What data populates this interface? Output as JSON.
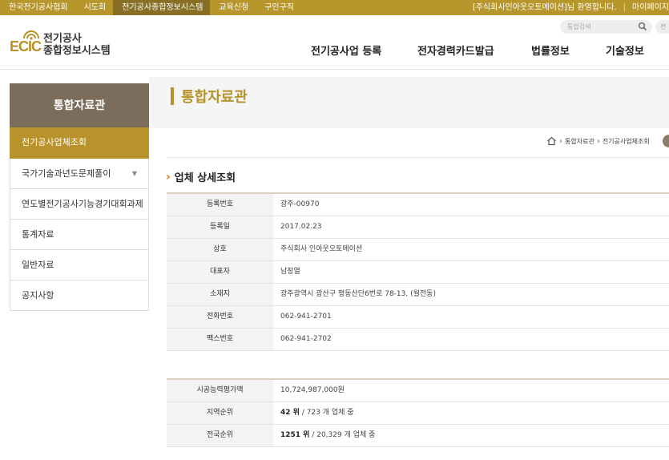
{
  "topbar": {
    "links": [
      "한국전기공사협회",
      "시도회",
      "전기공사종합정보시스템",
      "교육신청",
      "구인구직"
    ],
    "active_index": 2,
    "welcome": "[주식회사인아웃오토메이션]님 환영합니다.",
    "mypage": "마이페이지"
  },
  "header": {
    "logo_mark": "ECIC",
    "logo_line1": "전기공사",
    "logo_line2": "종합정보시스템",
    "search_placeholder": "통합검색",
    "search_button2": "전",
    "nav": [
      "전기공사업 등록",
      "전자경력카드발급",
      "법률정보",
      "기술정보"
    ]
  },
  "sidebar": {
    "title": "통합자료관",
    "items": [
      {
        "label": "전기공사업체조회"
      },
      {
        "label": "국가기술과년도문제풀이",
        "arrow": "▼"
      },
      {
        "label": "연도별전기공사기능경기대회과제"
      },
      {
        "label": "통계자료"
      },
      {
        "label": "일반자료"
      },
      {
        "label": "공지사항"
      }
    ],
    "active_index": 0
  },
  "page": {
    "title": "통합자료관",
    "breadcrumb": [
      "통합자료관",
      "전기공사업체조회"
    ],
    "section_title": "업체 상세조회"
  },
  "detail": [
    {
      "label": "등록번호",
      "value": "광주-00970"
    },
    {
      "label": "등록일",
      "value": "2017.02.23"
    },
    {
      "label": "상호",
      "value": "주식회사 인아웃오토메이션"
    },
    {
      "label": "대표자",
      "value": "남창열"
    },
    {
      "label": "소재지",
      "value": "광주광역시 광산구 평동산단6번로 78-13, (월전동)"
    },
    {
      "label": "전화번호",
      "value": "062-941-2701"
    },
    {
      "label": "팩스번호",
      "value": "062-941-2702"
    }
  ],
  "capacity": {
    "eval_label": "시공능력평가액",
    "eval_value": "10,724,987,000원",
    "regional_label": "지역순위",
    "regional_rank": "42 위",
    "regional_total": " / 723 개 업체 중",
    "national_label": "전국순위",
    "national_rank": "1251 위",
    "national_total": " / 20,329 개 업체 중"
  },
  "colors": {
    "brand_gold": "#b8922a",
    "topbar": "#b7962b",
    "sidebar_title": "#7a6d5b",
    "accent_orange": "#e07a1a"
  }
}
